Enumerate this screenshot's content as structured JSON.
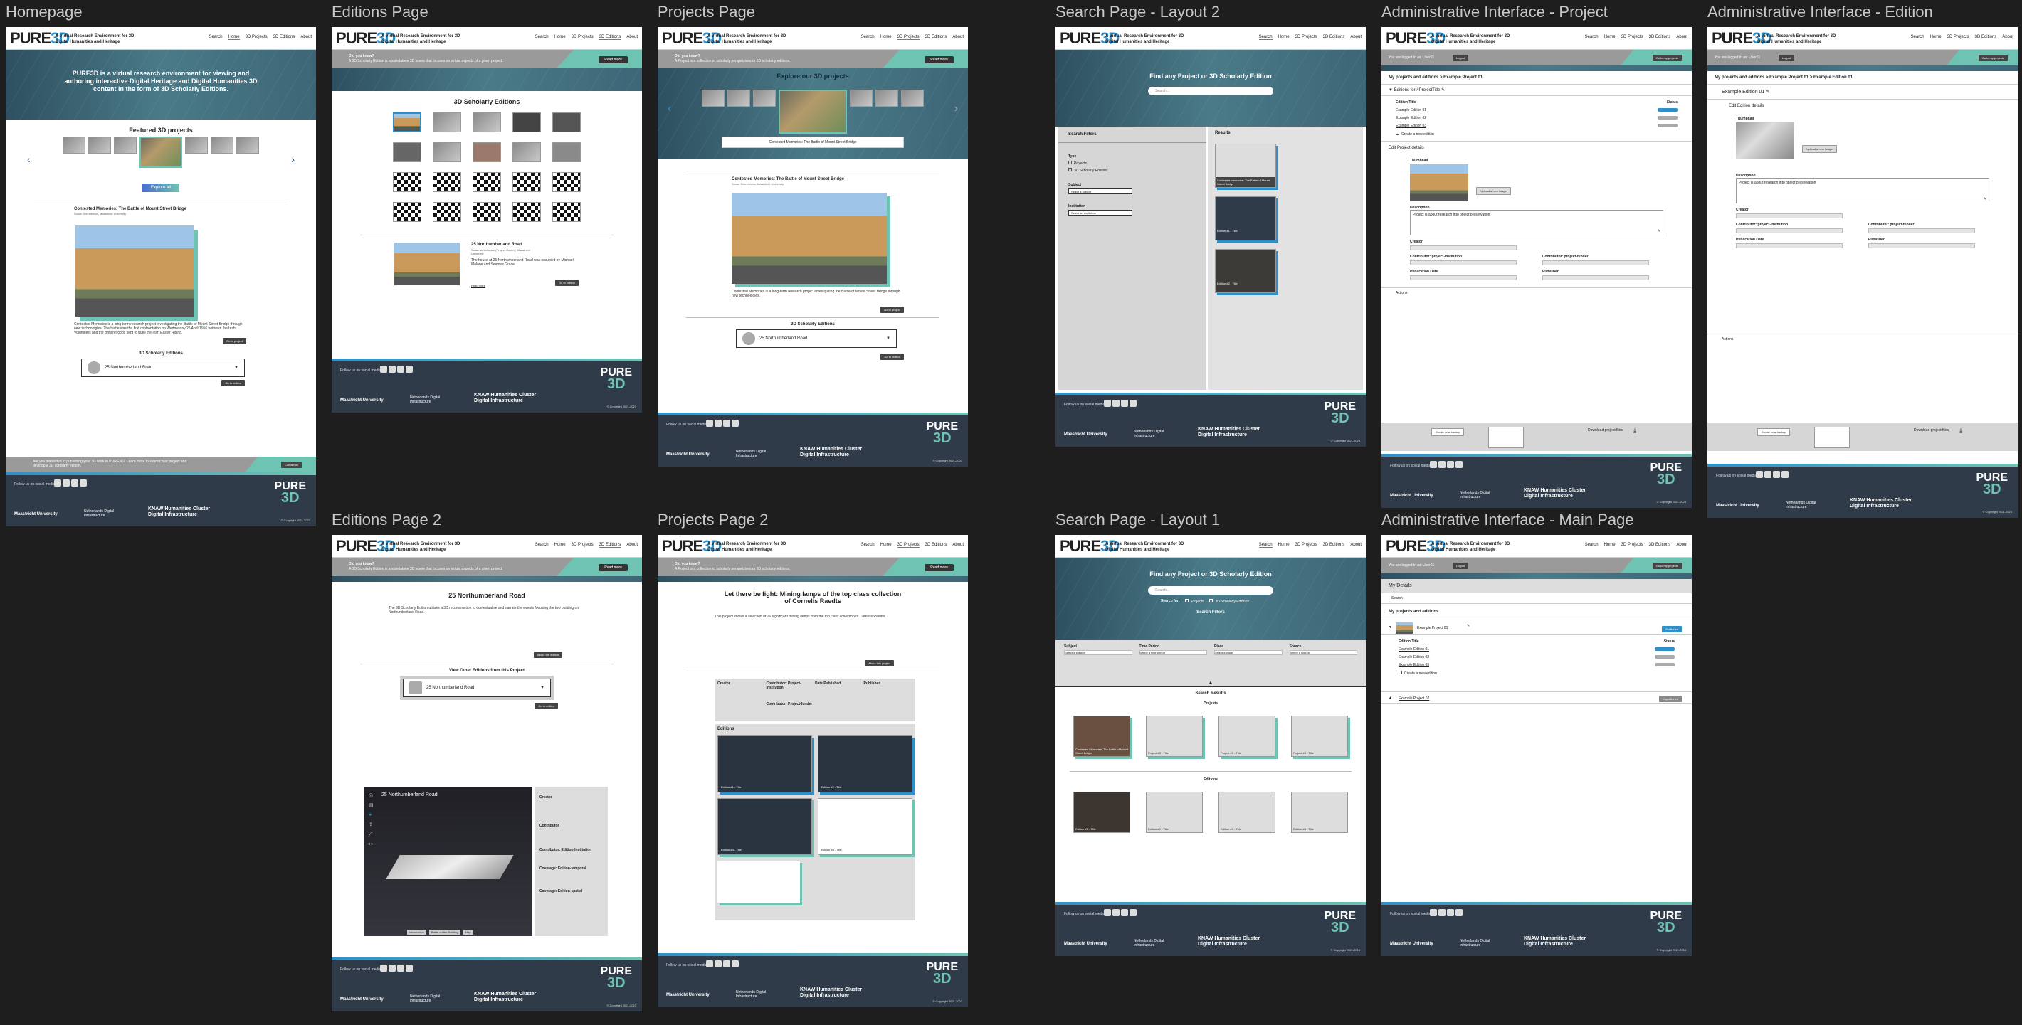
{
  "frames": {
    "homepage": "Homepage",
    "editions": "Editions Page",
    "projects": "Projects Page",
    "search2": "Search Page - Layout 2",
    "adminProject": "Administrative Interface - Project",
    "adminEdition": "Administrative Interface - Edition",
    "editions2": "Editions Page 2",
    "projects2": "Projects Page 2",
    "search1": "Search Page - Layout 1",
    "adminMain": "Administrative Interface - Main Page"
  },
  "header": {
    "logo": "PURE",
    "logo_accent": "3D",
    "tagline": "A Virtual Research Environment for 3D Digital Humanities and Heritage",
    "nav": [
      "Search",
      "Home",
      "3D Projects",
      "3D Editions",
      "About"
    ]
  },
  "home": {
    "hero": "PURE3D is a virtual research environment for viewing and authoring interactive Digital Heritage and Digital Humanities 3D content in the form of 3D Scholarly Editions.",
    "featured": "Featured 3D projects",
    "explore_btn": "Explore all",
    "project_title": "Contested Memories: The Battle of Mount Street Bridge",
    "project_sub": "Susan Schreibman, Maastricht University",
    "description": "Contested Memories is a long-term research project investigating the Battle of Mount Street Bridge through new technologies. The battle was the first confrontation on Wednesday 26 April 1916 between the Irish Volunteers and the British troops sent to quell the Irish Easter Rising.",
    "read_more": "Go to project",
    "editions_title": "3D Scholarly Editions",
    "edition_select": "25 Northumberland Road",
    "go_edition": "Go to edition",
    "banner": "Are you interested in publishing your 3D work in PURE3D? Learn more to submit your project and develop a 3D scholarly edition.",
    "banner_btn": "Contact us"
  },
  "didyou": {
    "title": "Did you know?",
    "editions_text": "A 3D Scholarly Edition is a standalone 3D scene that focuses on virtual aspects of a given project.",
    "projects_text": "A Project is a collection of scholarly perspectives or 3D scholarly editions.",
    "btn": "Read more"
  },
  "editions_page": {
    "title": "3D Scholarly Editions",
    "item_title": "25 Northumberland Road",
    "item_sub": "Susan schreibman (Project Owner), Maastricht University",
    "item_text": "The house at 25 Northumberland Road was occupied by Michael Malone and Seamus Grace.",
    "more": "Go to edition",
    "credits": "Read more"
  },
  "projects_page": {
    "title": "Explore our 3D projects",
    "caption": "Contested Memories: The Battle of Mount Street Bridge",
    "project_title": "Contested Memories: The Battle of Mount Street Bridge",
    "project_sub": "Susan Schreibman, Maastricht University",
    "description": "Contested Memories is a long-term research project investigating the Battle of Mount Street Bridge through new technologies.",
    "go_project": "Go to project",
    "editions_title": "3D Scholarly Editions",
    "edition_select": "25 Northumberland Road",
    "go_edition": "Go to edition"
  },
  "search2": {
    "title": "Find any Project or 3D Scholarly Edition",
    "placeholder": "Search...",
    "filters": "Search Filters",
    "type": "Type",
    "opt_project": "Projects",
    "opt_edition": "3D Scholarly Editions",
    "subject": "Subject",
    "subject_sel": "Select a subject",
    "institution": "Institution",
    "institution_sel": "Select an institution",
    "results": "Results",
    "r1": "Contested memories: The Battle of Mount Street Bridge",
    "r2": "Edition #1 - Title",
    "r3": "Edition #2 - Title"
  },
  "search1": {
    "title": "Find any Project or 3D Scholarly Edition",
    "placeholder": "Search...",
    "search_for": "Search for:",
    "opt_project": "Projects",
    "opt_edition": "3D Scholarly Editions",
    "filters": "Search Filters",
    "f_subject": "Subject",
    "f_time": "Time Period",
    "f_place": "Place",
    "f_source": "Source",
    "sel_subject": "Select a subject",
    "sel_time": "Select a time period",
    "sel_place": "Select a place",
    "sel_source": "Select a source",
    "results": "Search Results",
    "projects": "Projects",
    "editions": "Editions",
    "p1": "Contested Memories: The Battle of Mount Street Bridge",
    "p2": "Project #2 - Title",
    "p3": "Project #3 - Title",
    "p4": "Project #4 - Title",
    "e1": "Edition #1 - Title",
    "e2": "Edition #2 - Title",
    "e3": "Edition #3 - Title",
    "e4": "Edition #4 - Title"
  },
  "admin": {
    "logged": "You are logged in as: User01",
    "logout": "Logout",
    "go": "Go to my projects",
    "crumb_project": "My projects and editions > Example Project 01",
    "crumb_edition": "My projects and editions > Example Project 01 > Example Edition 01",
    "editions_for": "Editions for #ProjectTitle",
    "edition_title": "Edition Title",
    "status": "Status",
    "ed1": "Example Edition 01",
    "ed2": "Example Edition 02",
    "ed3": "Example Edition 03",
    "create": "Create a new edition",
    "edit_project": "Edit Project details",
    "edit_edition": "Edit Edition details",
    "thumbnail": "Thumbnail",
    "upload": "Upload a new image",
    "description": "Description",
    "desc_text": "Project is about research into object preservation",
    "desc_edition": "Project is about research into object preservation",
    "creator": "Creator",
    "contributor_inst": "Contributor: project-institution",
    "contributor_funder": "Contributor: project-funder",
    "pub_date": "Publication Date",
    "publisher": "Publisher",
    "actions": "Actions",
    "backup": "Create new backup",
    "download": "Download project files",
    "edition_header": "Example Edition 01"
  },
  "admin_main": {
    "details": "My Details",
    "search": "Search",
    "projects": "My projects and editions",
    "project1": "Example Project 01",
    "project2": "Example Project 02",
    "status_pub": "Published",
    "status_draft": "Unpublished",
    "edition_title": "Edition Title",
    "status": "Status",
    "ed1": "Example Edition 01",
    "ed2": "Example Edition 02",
    "ed3": "Example Edition 03",
    "create": "Create a new edition"
  },
  "editions2": {
    "title": "25 Northumberland Road",
    "text": "The 3D Scholarly Edition utilises a 3D reconstruction to contextualise and narrate the events focusing the two building on Northumberland Road.",
    "about": "About the edition",
    "other": "View Other Editions from this Project",
    "select": "25 Northumberland Road",
    "go": "Go to edition",
    "viewer_title": "25 Northumberland Road",
    "creator": "Creator",
    "contributor": "Contributor",
    "contributor_inst": "Contributor: Edition-Institution",
    "coverage_temp": "Coverage: Edition-temporal",
    "coverage_spatial": "Coverage: Edition-spatial",
    "viewer_tabs": [
      "Introduction",
      "Battle on the Building",
      "Map"
    ]
  },
  "projects2": {
    "title": "Let there be light: Mining lamps of the top class collection of Cornelis Raedts",
    "text": "This project shows a selection of 26 significant mining lamps from the top class collection of Cornelis Raedts.",
    "about": "About this project",
    "creator": "Creator",
    "contributor": "Contributor: Project-Institution",
    "date": "Date Published",
    "publisher": "Publisher",
    "funder": "Contributor: Project-funder",
    "editions": "Editions",
    "ed1": "Edition #1 - Title",
    "ed2": "Edition #2 - Title",
    "ed3": "Edition #3 - Title",
    "ed4": "Edition #4 - Title"
  },
  "footer": {
    "follow": "Follow us on social media",
    "um": "Maastricht University",
    "nl": "Netherlands Digital Infrastructure",
    "knaw": "KNAW Humanities Cluster",
    "di": "Digital Infrastructure",
    "logo": "PURE",
    "logo_accent": "3D",
    "copy": "© Copyright 2021-2023"
  }
}
